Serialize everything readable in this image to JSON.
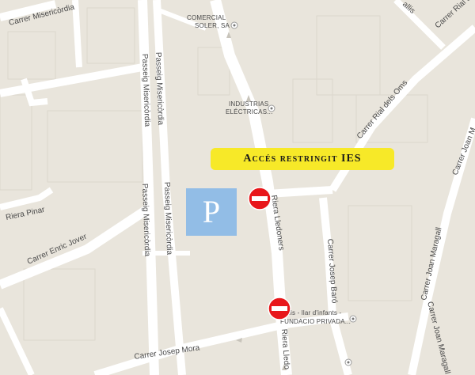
{
  "streets": {
    "carrer_misericordia": "Carrer Misericòrdia",
    "passeig_misericordia_1": "Passeig Misericòrdia",
    "passeig_misericordia_2": "Passeig Misericòrdia",
    "passeig_misericordia_3": "Passeig Misericòrdia",
    "passeig_misericordia_4": "Passeig Misericòrdia",
    "riera_pinar": "Riera Pinar",
    "carrer_enric_jover": "Carrer Enric Jover",
    "riera_lledoners_1": "Riera Lledoners",
    "riera_lledoners_2": "Riera Lledo",
    "carrer_josep_baro": "Carrer Josep Baró",
    "carrer_josep_mora": "Carrer Josep Mora",
    "carrer_rial_dels_oms_1": "Carrer Rial dels Oms",
    "carrer_rial_dels_oms_2": "Carrer Rial dels",
    "carrer_joan_maragall_1": "Carrer Joan Maragall",
    "carrer_joan_maragall_2": "Carrer Joan Maragall",
    "carrer_joan_m": "Carrer Joan M",
    "allis": "allis"
  },
  "pois": {
    "comercial_soler_1": "COMERCIAL",
    "comercial_soler_2": "SOLER, SA",
    "industrias_1": "INDUSTRIAS",
    "industrias_2": "ELÉCTRICAS...",
    "llar_1": "lis - llar d'infants -",
    "llar_2": "FUNDACIO PRIVADA..."
  },
  "overlays": {
    "parking_label": "P",
    "restricted_banner": "Accés restringit IES"
  },
  "icons": {
    "poi_marker": "poi-marker-icon",
    "no_entry": "no-entry-sign-icon",
    "parking": "parking-sign"
  },
  "colors": {
    "background": "#e9e5dc",
    "road": "#ffffff",
    "parking": "#92bde6",
    "banner": "#f7e928",
    "no_entry_red": "#e8161a"
  }
}
